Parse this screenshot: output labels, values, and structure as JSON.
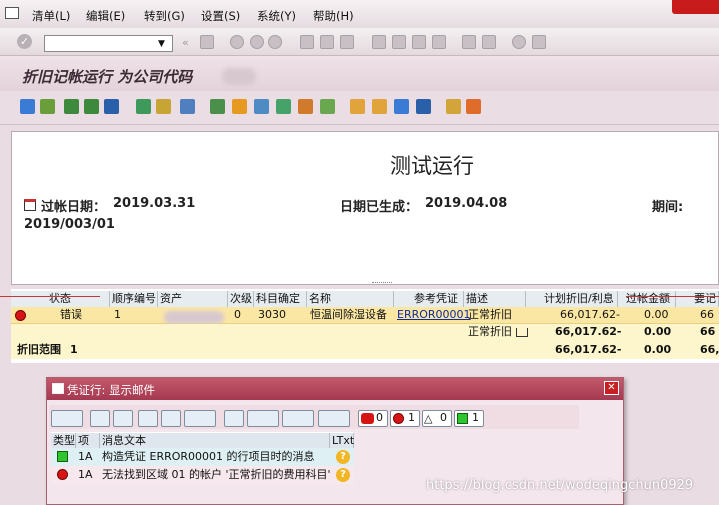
{
  "menu": {
    "items": [
      "清单(L)",
      "编辑(E)",
      "转到(G)",
      "设置(S)",
      "系统(Y)",
      "帮助(H)"
    ]
  },
  "title": "折旧记帐运行 为公司代码 ",
  "report": {
    "heading": "测试运行",
    "posting_date_label": "过帐日期：",
    "posting_date": "2019.03.31",
    "created_label": "日期已生成：",
    "created_date": "2019.04.08",
    "period_label": "期间:",
    "period": "2019/003/01"
  },
  "grid": {
    "headers": [
      "状态",
      "顺序编号",
      "资产",
      "次级",
      "科目确定",
      "名称",
      "参考凭证",
      "描述",
      "计划折旧/利息",
      "过帐金额",
      "要记"
    ],
    "row1": {
      "status": "错误",
      "seq": "1",
      "asset": "",
      "sub": "0",
      "acct": "3030",
      "name": "恒温间除湿设备",
      "ref": "ERROR00001",
      "desc": "正常折旧",
      "planned": "66,017.62-",
      "posted": "0.00",
      "more": "66"
    },
    "row2": {
      "desc": "正常折旧",
      "planned": "66,017.62-",
      "posted": "0.00",
      "more": "66"
    },
    "row3": {
      "label": "折旧范围",
      "value": "1",
      "planned": "66,017.62-",
      "posted": "0.00",
      "more": "66,"
    }
  },
  "dialog": {
    "title": "凭证行: 显示邮件",
    "counts": {
      "stop": "0",
      "red": "1",
      "yellow": "0",
      "green": "1"
    },
    "headers": [
      "类型",
      "项目",
      "消息文本",
      "LTxt"
    ],
    "messages": [
      {
        "item": "1A",
        "text": "构造凭证 ERROR00001 的行项目时的消息"
      },
      {
        "item": "1A",
        "text": "无法找到区域 01 的帐户 '正常折旧的费用科目'"
      }
    ]
  },
  "watermark": "https://blog.csdn.net/wodeqingchun0929",
  "colors": {
    "title_bar": "#a43850",
    "row_error": "#fbe7a4",
    "subtotal": "#fdf6cc",
    "status_red": "#d71414",
    "status_green": "#2fc52f"
  }
}
